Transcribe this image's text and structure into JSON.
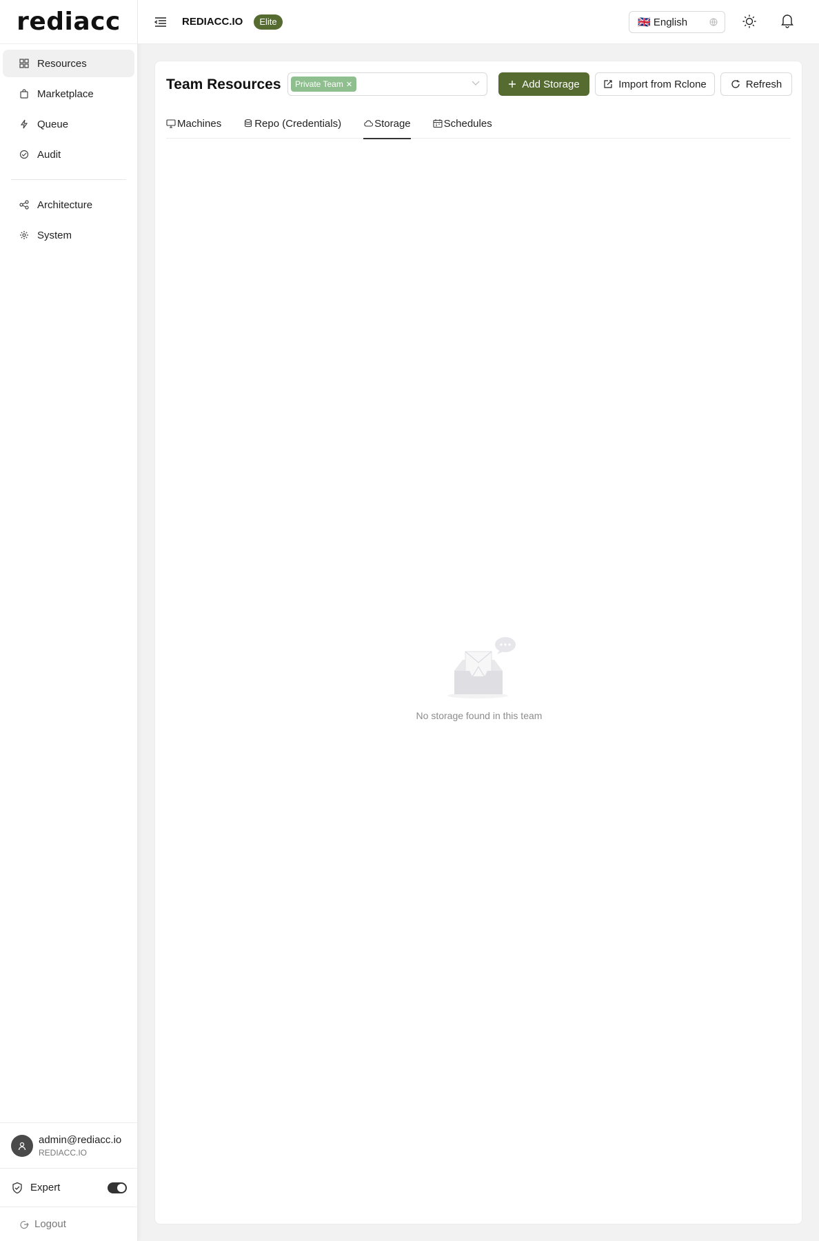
{
  "brand": {
    "logo_text": "rediacc"
  },
  "sidebar": {
    "items": [
      {
        "label": "Resources",
        "icon": "grid-icon",
        "active": true
      },
      {
        "label": "Marketplace",
        "icon": "shopping-bag-icon",
        "active": false
      },
      {
        "label": "Queue",
        "icon": "thunderbolt-icon",
        "active": false
      },
      {
        "label": "Audit",
        "icon": "audit-icon",
        "active": false
      },
      {
        "label": "Architecture",
        "icon": "share-nodes-icon",
        "active": false
      },
      {
        "label": "System",
        "icon": "settings-icon",
        "active": false
      }
    ],
    "user": {
      "email": "admin@rediacc.io",
      "org": "REDIACC.IO"
    },
    "expert_label": "Expert",
    "expert_enabled": true,
    "logout_label": "Logout"
  },
  "header": {
    "org_name": "REDIACC.IO",
    "tier": "Elite",
    "language": "🇬🇧 English"
  },
  "main": {
    "title": "Team Resources",
    "team_tag": "Private Team",
    "buttons": {
      "add_storage": "Add Storage",
      "import": "Import from Rclone",
      "refresh": "Refresh"
    },
    "tabs": [
      {
        "label": "Machines",
        "icon": "desktop-icon",
        "active": false
      },
      {
        "label": "Repo (Credentials)",
        "icon": "database-icon",
        "active": false
      },
      {
        "label": "Storage",
        "icon": "cloud-icon",
        "active": true
      },
      {
        "label": "Schedules",
        "icon": "schedule-icon",
        "active": false
      }
    ],
    "empty_text": "No storage found in this team"
  },
  "colors": {
    "accent": "#556b2f",
    "tag": "#8fbf8f"
  }
}
